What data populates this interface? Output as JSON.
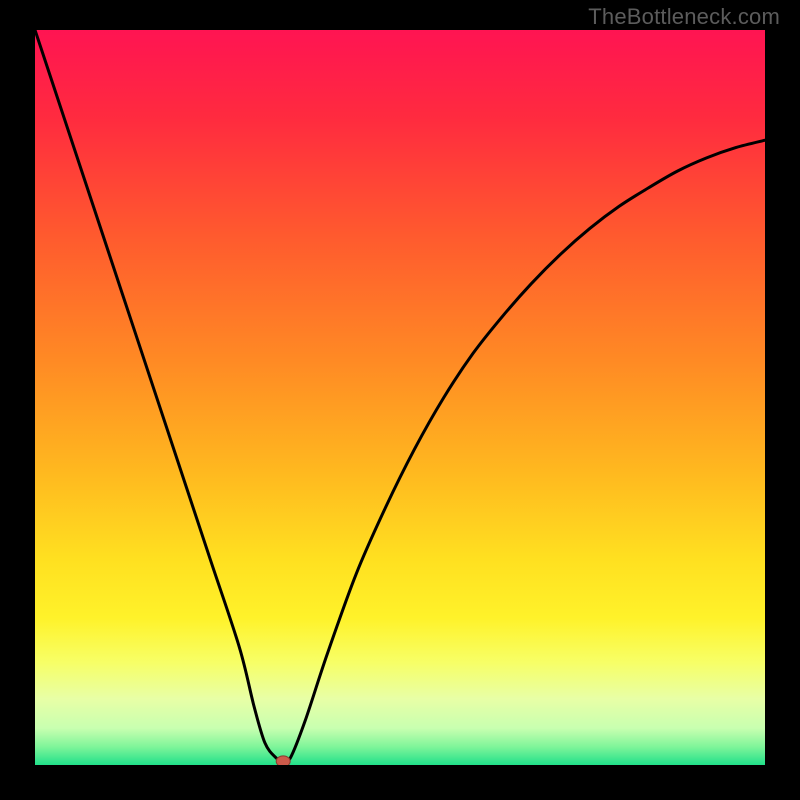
{
  "watermark": "TheBottleneck.com",
  "colors": {
    "frame": "#000000",
    "watermark": "#5c5c5c",
    "curve": "#000000",
    "marker_fill": "#cc5a4a",
    "marker_stroke": "#8a3a30",
    "gradient_stops": [
      {
        "offset": 0.0,
        "color": "#ff1452"
      },
      {
        "offset": 0.12,
        "color": "#ff2b3f"
      },
      {
        "offset": 0.28,
        "color": "#ff5a2e"
      },
      {
        "offset": 0.45,
        "color": "#ff8a24"
      },
      {
        "offset": 0.6,
        "color": "#ffb81f"
      },
      {
        "offset": 0.72,
        "color": "#ffe020"
      },
      {
        "offset": 0.8,
        "color": "#fff22a"
      },
      {
        "offset": 0.86,
        "color": "#f7ff66"
      },
      {
        "offset": 0.91,
        "color": "#e8ffa6"
      },
      {
        "offset": 0.95,
        "color": "#c8ffb0"
      },
      {
        "offset": 0.975,
        "color": "#80f59a"
      },
      {
        "offset": 1.0,
        "color": "#21e08a"
      }
    ]
  },
  "chart_data": {
    "type": "line",
    "title": "",
    "xlabel": "",
    "ylabel": "",
    "xlim": [
      0,
      100
    ],
    "ylim": [
      0,
      100
    ],
    "series": [
      {
        "name": "bottleneck-curve",
        "x": [
          0,
          4,
          8,
          12,
          16,
          20,
          24,
          28,
          30,
          31.5,
          33,
          34,
          35,
          37,
          40,
          44,
          48,
          52,
          56,
          60,
          64,
          68,
          72,
          76,
          80,
          84,
          88,
          92,
          96,
          100
        ],
        "y": [
          100,
          88,
          76,
          64,
          52,
          40,
          28,
          16,
          8,
          3,
          1,
          0.5,
          1,
          6,
          15,
          26,
          35,
          43,
          50,
          56,
          61,
          65.5,
          69.5,
          73,
          76,
          78.5,
          80.8,
          82.6,
          84,
          85
        ]
      }
    ],
    "marker": {
      "x": 34,
      "y": 0.5
    }
  }
}
